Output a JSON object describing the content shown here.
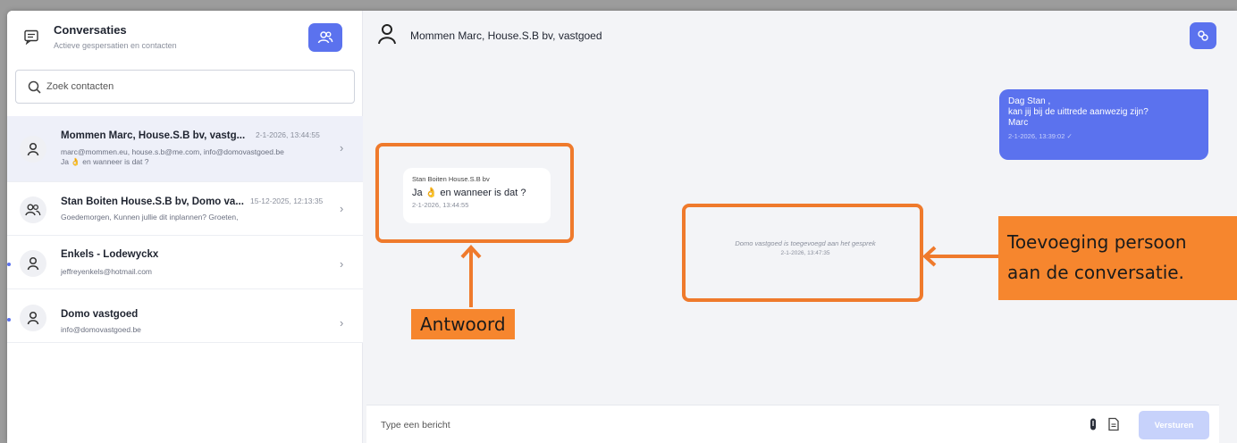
{
  "sidebar": {
    "title": "Conversaties",
    "subtitle": "Actieve gespersatien en contacten",
    "search_placeholder": "Zoek contacten",
    "contacts": [
      {
        "name": "Mommen Marc, House.S.B bv, vastg...",
        "date": "2-1-2026, 13:44:55",
        "line1": "marc@mommen.eu, house.s.b@me.com, info@domovastgoed.be",
        "line2": "Ja 👌 en wanneer is dat ?",
        "icon": "person-icon"
      },
      {
        "name": "Stan Boiten House.S.B bv, Domo va...",
        "date": "15-12-2025, 12:13:35",
        "line1": "Goedemorgen, Kunnen jullie dit inplannen? Groeten,",
        "icon": "group-icon"
      },
      {
        "name": "Enkels - Lodewyckx",
        "line1": "jeffreyenkels@hotmail.com",
        "icon": "person-icon"
      },
      {
        "name": "Domo vastgoed",
        "line1": "info@domovastgoed.be",
        "icon": "person-icon"
      }
    ]
  },
  "chat": {
    "header_name": "Mommen Marc, House.S.B bv, vastgoed",
    "outgoing": {
      "line1": "Dag Stan ,",
      "line2": "kan jij bij de uittrede aanwezig zijn?",
      "line3": "Marc",
      "meta": "2-1-2026, 13:39:02 ✓"
    },
    "incoming": {
      "sender": "Stan Boiten House.S.B bv",
      "text": "Ja 👌 en wanneer is dat ?",
      "date": "2-1-2026, 13:44:55"
    },
    "system": {
      "text": "Domo vastgoed is toegevoegd aan het gesprek",
      "date": "2-1-2026, 13:47:35"
    },
    "composer_placeholder": "Type een bericht",
    "send_label": "Versturen"
  },
  "annotations": {
    "answer_label": "Antwoord",
    "added_label_line1": "Toevoeging persoon",
    "added_label_line2": "aan de conversatie."
  },
  "colors": {
    "accent": "#5b72ee",
    "annotation": "#f6862e"
  }
}
